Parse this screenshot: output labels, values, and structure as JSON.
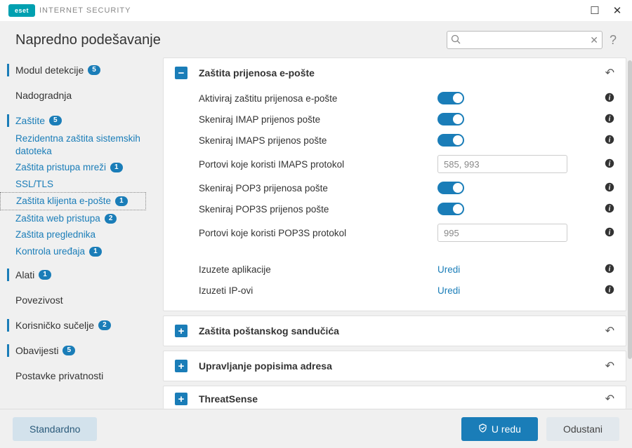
{
  "titlebar": {
    "logo": "eset",
    "product": "INTERNET SECURITY"
  },
  "header": {
    "title": "Napredno podešavanje",
    "search_placeholder": ""
  },
  "sidebar": [
    {
      "label": "Modul detekcije",
      "badge": "5",
      "type": "top",
      "indicator": true
    },
    {
      "label": "Nadogradnja",
      "type": "top"
    },
    {
      "label": "Zaštite",
      "badge": "5",
      "type": "top",
      "indicator": true,
      "active": true
    },
    {
      "label": "Rezidentna zaštita sistemskih datoteka",
      "type": "sub"
    },
    {
      "label": "Zaštita pristupa mreži",
      "badge": "1",
      "type": "sub"
    },
    {
      "label": "SSL/TLS",
      "type": "sub"
    },
    {
      "label": "Zaštita klijenta e-pošte",
      "badge": "1",
      "type": "sub",
      "selected": true
    },
    {
      "label": "Zaštita web pristupa",
      "badge": "2",
      "type": "sub"
    },
    {
      "label": "Zaštita preglednika",
      "type": "sub"
    },
    {
      "label": "Kontrola uređaja",
      "badge": "1",
      "type": "sub"
    },
    {
      "label": "Alati",
      "badge": "1",
      "type": "top",
      "indicator": true
    },
    {
      "label": "Povezivost",
      "type": "top"
    },
    {
      "label": "Korisničko sučelje",
      "badge": "2",
      "type": "top",
      "indicator": true
    },
    {
      "label": "Obavijesti",
      "badge": "5",
      "type": "top",
      "indicator": true
    },
    {
      "label": "Postavke privatnosti",
      "type": "top"
    }
  ],
  "panels": {
    "transport": {
      "title": "Zaštita prijenosa e-pošte",
      "expanded": true,
      "rows": [
        {
          "label": "Aktiviraj zaštitu prijenosa e-pošte",
          "kind": "toggle",
          "on": true
        },
        {
          "label": "Skeniraj IMAP prijenos pošte",
          "kind": "toggle",
          "on": true
        },
        {
          "label": "Skeniraj IMAPS prijenos pošte",
          "kind": "toggle",
          "on": true
        },
        {
          "label": "Portovi koje koristi IMAPS protokol",
          "kind": "input",
          "value": "585, 993"
        },
        {
          "label": "Skeniraj POP3 prijenosa pošte",
          "kind": "toggle",
          "on": true
        },
        {
          "label": "Skeniraj POP3S prijenos pošte",
          "kind": "toggle",
          "on": true
        },
        {
          "label": "Portovi koje koristi POP3S protokol",
          "kind": "input",
          "value": "995"
        },
        {
          "kind": "gap"
        },
        {
          "label": "Izuzete aplikacije",
          "kind": "link",
          "link_text": "Uredi"
        },
        {
          "label": "Izuzeti IP-ovi",
          "kind": "link",
          "link_text": "Uredi"
        }
      ]
    },
    "collapsed": [
      {
        "title": "Zaštita poštanskog sandučića"
      },
      {
        "title": "Upravljanje popisima adresa"
      },
      {
        "title": "ThreatSense"
      }
    ]
  },
  "footer": {
    "default": "Standardno",
    "ok": "U redu",
    "cancel": "Odustani"
  }
}
